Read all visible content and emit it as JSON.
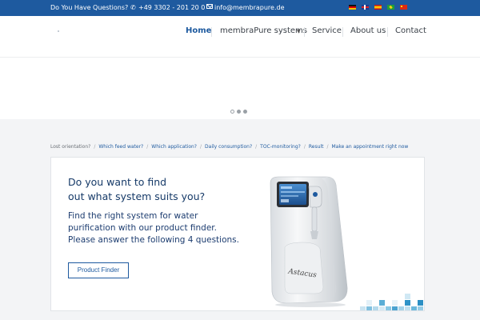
{
  "topbar": {
    "question": "Do You Have Questions?",
    "phone_icon": "phone-icon",
    "phone": "+49 3302 - 201 20 0",
    "mail_icon": "envelope-icon",
    "email": "info@membrapure.de",
    "flags": [
      "flag-de",
      "flag-gb",
      "flag-es",
      "flag-br",
      "flag-cn"
    ]
  },
  "nav": {
    "items": [
      {
        "label": "Home",
        "active": true
      },
      {
        "label": "membraPure systems",
        "has_dropdown": true
      },
      {
        "label": "Service"
      },
      {
        "label": "About us"
      },
      {
        "label": "Contact"
      }
    ],
    "caret_icon": "chevron-down-icon"
  },
  "slider": {
    "active_index": 0,
    "count": 3
  },
  "breadcrumb": {
    "lead": "Lost orientation?",
    "steps": [
      "Which feed water?",
      "Which application?",
      "Daily consumption?",
      "TOC-monitoring?",
      "Result",
      "Make an appointment right now"
    ]
  },
  "card": {
    "title_line1": "Do you want to find",
    "title_line2": "out what system suits you?",
    "desc_line1": "Find the right system for water",
    "desc_line2": "purification with our product finder.",
    "desc_line3": "Please answer the following 4 questions.",
    "button": "Product Finder",
    "device_brand": "Astacus"
  },
  "colors": {
    "brand_blue": "#1e5a9f",
    "heading_blue": "#163a68"
  }
}
